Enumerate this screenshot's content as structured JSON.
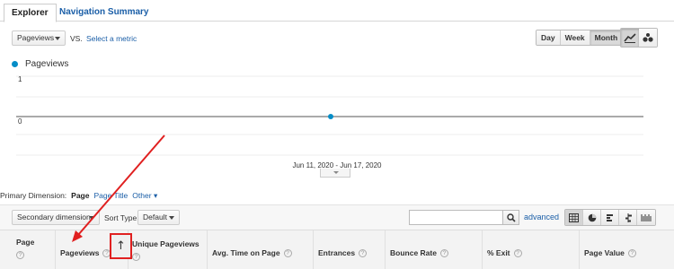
{
  "tabs": [
    {
      "label": "Explorer",
      "active": true
    },
    {
      "label": "Navigation Summary",
      "active": false
    }
  ],
  "controls": {
    "metric_select": "Pageviews",
    "vs_label": "VS.",
    "select_metric_link": "Select a metric",
    "periods": [
      {
        "label": "Day",
        "active": false
      },
      {
        "label": "Week",
        "active": false
      },
      {
        "label": "Month",
        "active": true
      }
    ],
    "chart_types": [
      {
        "icon": "line-chart-icon",
        "active": true
      },
      {
        "icon": "motion-chart-icon",
        "active": false
      }
    ]
  },
  "legend": {
    "label": "Pageviews",
    "color": "#058dc7"
  },
  "chart_data": {
    "type": "line",
    "series": [
      {
        "name": "Pageviews",
        "values": [
          0
        ],
        "color": "#058dc7"
      }
    ],
    "x": [
      "Jun 11, 2020 - Jun 17, 2020"
    ],
    "ylim": [
      0,
      1
    ],
    "yticks": [
      "0",
      "1"
    ],
    "date_range_label": "Jun 11, 2020 - Jun 17, 2020"
  },
  "dimensions": {
    "label": "Primary Dimension:",
    "active": "Page",
    "link": "Page Title",
    "other": "Other"
  },
  "secondary": {
    "secondary_dimension": "Secondary dimension",
    "sort_type_label": "Sort Type:",
    "sort_type_value": "Default",
    "search_placeholder": "",
    "advanced_link": "advanced",
    "view_icons": [
      "table-view-icon",
      "pie-view-icon",
      "performance-view-icon",
      "comparison-view-icon",
      "pivot-view-icon"
    ]
  },
  "table": {
    "headers": [
      {
        "key": "page",
        "label": "Page"
      },
      {
        "key": "pageviews",
        "label": "Pageviews"
      },
      {
        "key": "unique",
        "label": "Unique Pageviews"
      },
      {
        "key": "avgtime",
        "label": "Avg. Time on Page"
      },
      {
        "key": "entrances",
        "label": "Entrances"
      },
      {
        "key": "bounce",
        "label": "Bounce Rate"
      },
      {
        "key": "exit",
        "label": "% Exit"
      },
      {
        "key": "value",
        "label": "Page Value"
      }
    ],
    "help_glyph": "?",
    "sort_arrow": "↑"
  },
  "annotation": {
    "color": "#e02020"
  }
}
